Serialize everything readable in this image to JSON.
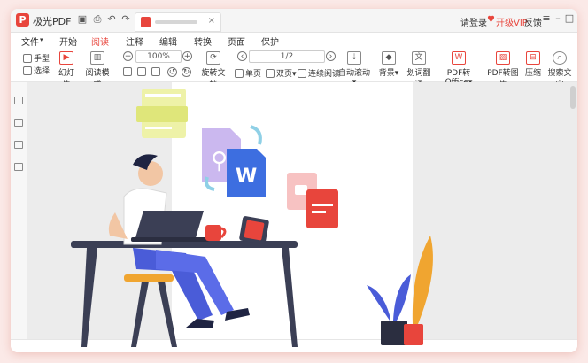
{
  "app": {
    "name": "极光PDF",
    "logo_letter": "P"
  },
  "titlebar": {
    "login": "请登录",
    "vip": "开级VIP",
    "feedback": "反馈",
    "tab_close": "×"
  },
  "menu": [
    "文件",
    "开始",
    "阅读",
    "注释",
    "编辑",
    "转换",
    "页面",
    "保护"
  ],
  "menu_file_arrow": "▾",
  "active_menu": "阅读",
  "toolbar": {
    "hand": "手型",
    "select": "选择",
    "slideshow": "幻灯片",
    "read_mode": "阅读模式",
    "zoom": "100%",
    "rotate": "旋转文档",
    "page": "1/2",
    "single": "单页",
    "double": "双页",
    "continuous": "连续阅读",
    "autoscroll": "自动滚动",
    "background": "背景",
    "translate": "划词翻译",
    "to_office": "PDF转Office",
    "to_image": "PDF转图片",
    "compress": "压缩",
    "search": "搜索文字"
  },
  "illustration": {
    "word_letter": "W"
  },
  "colors": {
    "accent": "#e8453c",
    "word": "#3d6ee0",
    "lime": "#eef2a8",
    "plant": "#4a5cd8",
    "orange": "#f0a530"
  }
}
